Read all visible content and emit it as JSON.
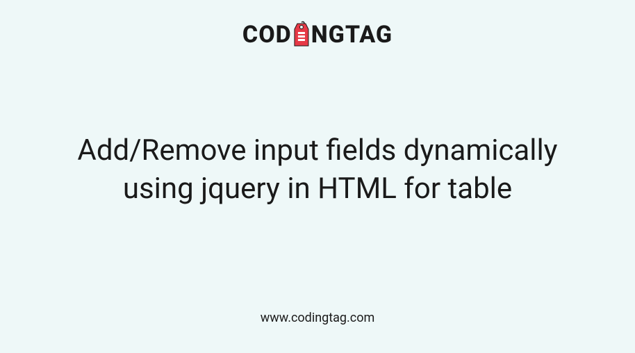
{
  "logo": {
    "text_before": "COD",
    "text_after": "NGTAG"
  },
  "title": "Add/Remove input fields dynamically using jquery in HTML for table",
  "footer_url": "www.codingtag.com"
}
